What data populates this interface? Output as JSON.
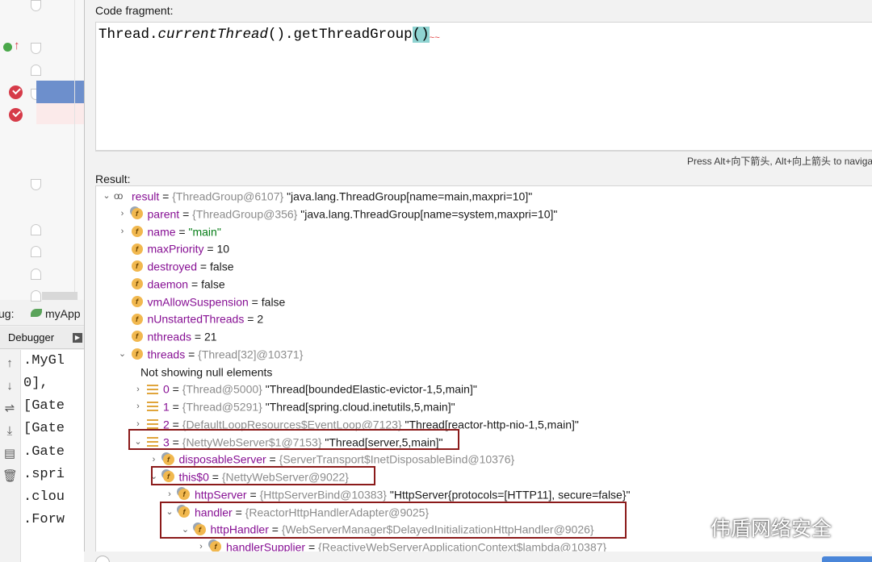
{
  "left_panel": {
    "debug_label": "ug:",
    "app_tab": "myApp",
    "debugger_tab": "Debugger",
    "console_lines": [
      ".MyGl",
      " 0],",
      "[Gate",
      "[Gate",
      ".Gate",
      ".spri",
      ".clou",
      ".Forw"
    ]
  },
  "dialog": {
    "code_label": "Code fragment:",
    "code": {
      "prefix": "Thread.",
      "italic": "currentThread",
      "middle": "().getThreadGroup",
      "highlight": "()",
      "squiggle": "~~"
    },
    "hint": "Press Alt+向下箭头, Alt+向上箭头 to navigat",
    "result_label": "Result:"
  },
  "tree": [
    {
      "chev": "⌄",
      "icon": "oo",
      "name": "result",
      "eq": " = ",
      "ref": "{ThreadGroup@6107}",
      "value": " \"java.lang.ThreadGroup[name=main,maxpri=10]\"",
      "vclass": "str"
    },
    {
      "chev": "›",
      "icon": "f-final",
      "name": "parent",
      "eq": " = ",
      "ref": "{ThreadGroup@356}",
      "value": " \"java.lang.ThreadGroup[name=system,maxpri=10]\"",
      "vclass": "str"
    },
    {
      "chev": "›",
      "icon": "f",
      "name": "name",
      "eq": " = ",
      "ref": "",
      "value": "\"main\"",
      "vclass": "str-green"
    },
    {
      "chev": "",
      "icon": "f",
      "name": "maxPriority",
      "eq": " = ",
      "ref": "",
      "value": "10",
      "vclass": "plain"
    },
    {
      "chev": "",
      "icon": "f",
      "name": "destroyed",
      "eq": " = ",
      "ref": "",
      "value": "false",
      "vclass": "plain"
    },
    {
      "chev": "",
      "icon": "f",
      "name": "daemon",
      "eq": " = ",
      "ref": "",
      "value": "false",
      "vclass": "plain"
    },
    {
      "chev": "",
      "icon": "f",
      "name": "vmAllowSuspension",
      "eq": " = ",
      "ref": "",
      "value": "false",
      "vclass": "plain"
    },
    {
      "chev": "",
      "icon": "f",
      "name": "nUnstartedThreads",
      "eq": " = ",
      "ref": "",
      "value": "2",
      "vclass": "plain"
    },
    {
      "chev": "",
      "icon": "f",
      "name": "nthreads",
      "eq": " = ",
      "ref": "",
      "value": "21",
      "vclass": "plain"
    },
    {
      "chev": "⌄",
      "icon": "f",
      "name": "threads",
      "eq": " = ",
      "ref": "{Thread[32]@10371}",
      "value": "",
      "vclass": "plain"
    },
    {
      "chev": "",
      "icon": "none",
      "name": "",
      "eq": "",
      "ref": "",
      "value": "Not showing null elements",
      "vclass": "plain"
    },
    {
      "chev": "›",
      "icon": "arr",
      "name": "0",
      "eq": " = ",
      "ref": "{Thread@5000}",
      "value": " \"Thread[boundedElastic-evictor-1,5,main]\"",
      "vclass": "str"
    },
    {
      "chev": "›",
      "icon": "arr",
      "name": "1",
      "eq": " = ",
      "ref": "{Thread@5291}",
      "value": " \"Thread[spring.cloud.inetutils,5,main]\"",
      "vclass": "str"
    },
    {
      "chev": "›",
      "icon": "arr",
      "name": "2",
      "eq": " = ",
      "ref": "{DefaultLoopResources$EventLoop@7123}",
      "value": " \"Thread[reactor-http-nio-1,5,main]\"",
      "vclass": "str"
    },
    {
      "chev": "⌄",
      "icon": "arr",
      "name": "3",
      "eq": " = ",
      "ref": "{NettyWebServer$1@7153}",
      "value": " \"Thread[server,5,main]\"",
      "vclass": "str"
    },
    {
      "chev": "›",
      "icon": "f-final",
      "name": "disposableServer",
      "eq": " = ",
      "ref": "{ServerTransport$InetDisposableBind@10376}",
      "value": "",
      "vclass": "plain"
    },
    {
      "chev": "⌄",
      "icon": "f-final",
      "name": "this$0",
      "eq": " = ",
      "ref": "{NettyWebServer@9022}",
      "value": "",
      "vclass": "plain"
    },
    {
      "chev": "›",
      "icon": "f-final",
      "name": "httpServer",
      "eq": " = ",
      "ref": "{HttpServerBind@10383}",
      "value": " \"HttpServer{protocols=[HTTP11], secure=false}\"",
      "vclass": "str"
    },
    {
      "chev": "⌄",
      "icon": "f-final",
      "name": "handler",
      "eq": " = ",
      "ref": "{ReactorHttpHandlerAdapter@9025}",
      "value": "",
      "vclass": "plain"
    },
    {
      "chev": "⌄",
      "icon": "f-final",
      "name": "httpHandler",
      "eq": " = ",
      "ref": "{WebServerManager$DelayedInitializationHttpHandler@9026}",
      "value": "",
      "vclass": "plain"
    },
    {
      "chev": "›",
      "icon": "f-final",
      "name": "handlerSupplier",
      "eq": " = ",
      "ref": "{ReactiveWebServerApplicationContext$lambda@10387}",
      "value": "",
      "vclass": "plain"
    }
  ],
  "watermark": "伟盾网络安全",
  "colors": {
    "field_name": "#871094",
    "reference": "#8c8c8c",
    "string_green": "#067d17",
    "annotation_box": "#8b1a1a",
    "selection_line": "#6d8fcc"
  }
}
